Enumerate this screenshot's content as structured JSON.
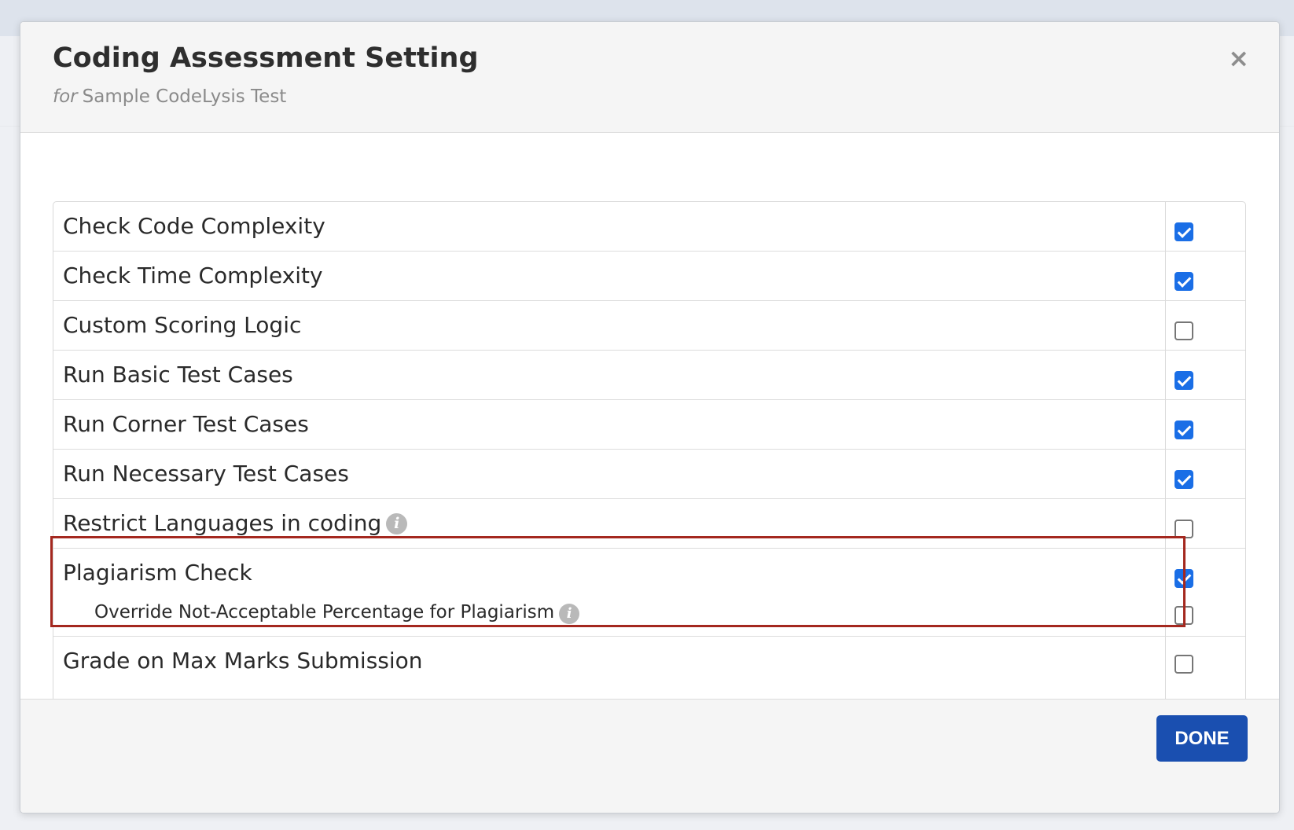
{
  "modal": {
    "title": "Coding Assessment Setting",
    "subtitle_prefix": "for",
    "subtitle_name": "Sample CodeLysis Test",
    "close_label": "×",
    "done_label": "DONE"
  },
  "settings": [
    {
      "label": "Check Code Complexity",
      "checked": true
    },
    {
      "label": "Check Time Complexity",
      "checked": true
    },
    {
      "label": "Custom Scoring Logic",
      "checked": false
    },
    {
      "label": "Run Basic Test Cases",
      "checked": true
    },
    {
      "label": "Run Corner Test Cases",
      "checked": true
    },
    {
      "label": "Run Necessary Test Cases",
      "checked": true
    },
    {
      "label": "Restrict Languages in coding",
      "checked": false,
      "info_icon": "info-icon"
    },
    {
      "label": "Plagiarism Check",
      "checked": true,
      "sub_label": "Override Not-Acceptable Percentage for Plagiarism",
      "sub_checked": false,
      "sub_info_icon": "info-icon"
    },
    {
      "label": "Grade on Max Marks Submission",
      "checked": false
    }
  ],
  "info_icon_glyph": "i",
  "colors": {
    "accent": "#1a6ee6",
    "done_button": "#1a4fb0",
    "highlight": "#a4281f"
  }
}
